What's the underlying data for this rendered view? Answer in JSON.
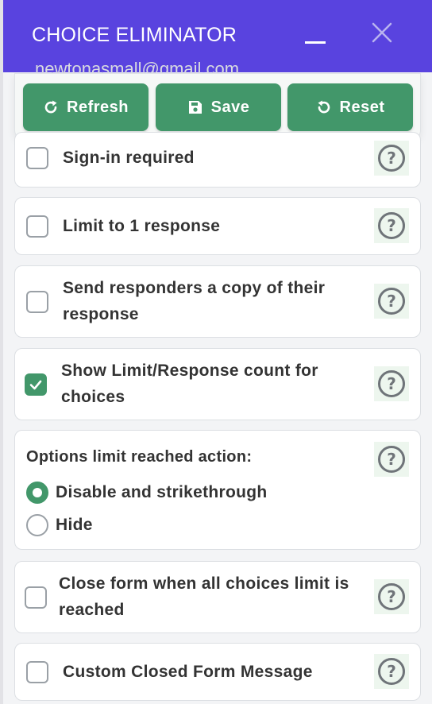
{
  "header": {
    "title": "CHOICE ELIMINATOR",
    "minimize_icon": "minimize-icon",
    "close_icon": "close-icon",
    "accent": "#5943df"
  },
  "background_email": "newtonasmall@gmail.com",
  "toolbar": {
    "refresh_label": "Refresh",
    "save_label": "Save",
    "reset_label": "Reset",
    "button_color": "#42976a"
  },
  "settings": [
    {
      "label": "Sign-in required",
      "checked": false
    },
    {
      "label": "Limit to 1 response",
      "checked": false
    },
    {
      "label_line1": "Send responders a copy of their",
      "label_line2": "response",
      "checked": false
    },
    {
      "label_line1": "Show Limit/Response count for",
      "label_line2": "choices",
      "checked": true
    },
    {
      "label_line1": "Close form when all choices limit is",
      "label_line2": "reached",
      "checked": false
    },
    {
      "label": "Custom Closed Form Message",
      "checked": false
    }
  ],
  "limit_action": {
    "heading": "Options limit reached action:",
    "options": [
      {
        "label": "Disable and strikethrough",
        "selected": true
      },
      {
        "label": "Hide",
        "selected": false
      }
    ]
  },
  "help_icon": "help-circle-icon"
}
